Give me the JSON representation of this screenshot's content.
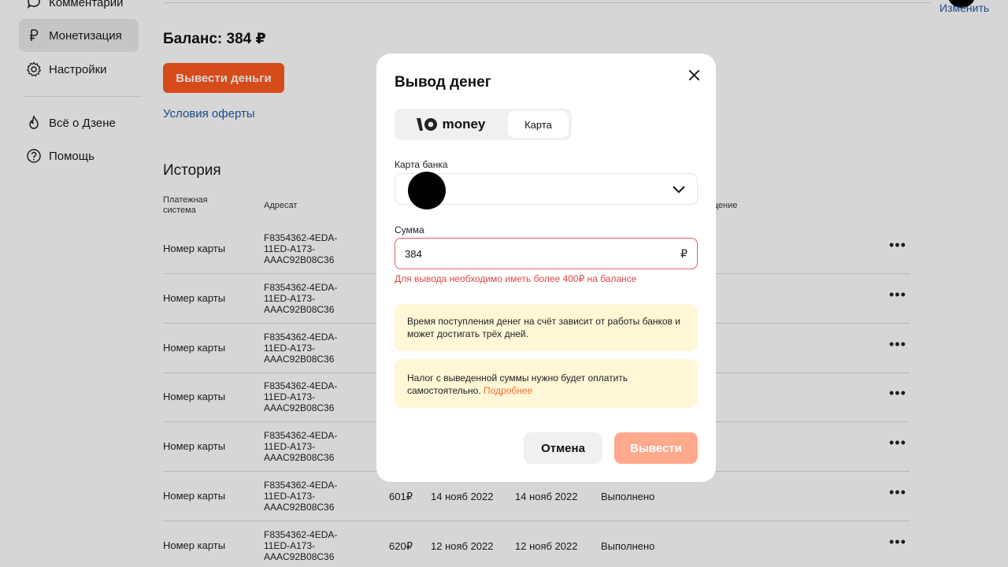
{
  "sidebar": {
    "items": [
      {
        "label": "Комментарии",
        "icon": "comment-icon"
      },
      {
        "label": "Монетизация",
        "icon": "ruble-icon",
        "active": true
      },
      {
        "label": "Настройки",
        "icon": "gear-icon"
      },
      {
        "label": "Всё о Дзене",
        "icon": "flame-icon"
      },
      {
        "label": "Помощь",
        "icon": "help-icon"
      }
    ]
  },
  "header": {
    "change_link": "Изменить"
  },
  "balance": {
    "text": "Баланс: 384 ₽",
    "withdraw_button": "Вывести деньги",
    "offer_link": "Условия оферты"
  },
  "history": {
    "title": "История",
    "columns": [
      "Платежная система",
      "Адресат",
      "щение"
    ],
    "rows": [
      {
        "system": "Номер карты",
        "address": "F8354362-4EDA-11ED-A173-AAAC92B08C36",
        "amount": "",
        "date1": "",
        "date2": "",
        "status": ""
      },
      {
        "system": "Номер карты",
        "address": "F8354362-4EDA-11ED-A173-AAAC92B08C36",
        "amount": "",
        "date1": "",
        "date2": "",
        "status": ""
      },
      {
        "system": "Номер карты",
        "address": "F8354362-4EDA-11ED-A173-AAAC92B08C36",
        "amount": "",
        "date1": "",
        "date2": "",
        "status": ""
      },
      {
        "system": "Номер карты",
        "address": "F8354362-4EDA-11ED-A173-AAAC92B08C36",
        "amount": "",
        "date1": "",
        "date2": "",
        "status": ""
      },
      {
        "system": "Номер карты",
        "address": "F8354362-4EDA-11ED-A173-AAAC92B08C36",
        "amount": "",
        "date1": "",
        "date2": "",
        "status": ""
      },
      {
        "system": "Номер карты",
        "address": "F8354362-4EDA-11ED-A173-AAAC92B08C36",
        "amount": "601₽",
        "date1": "14 нояб 2022",
        "date2": "14 нояб 2022",
        "status": "Выполнено"
      },
      {
        "system": "Номер карты",
        "address": "F8354362-4EDA-11ED-A173-AAAC92B08C36",
        "amount": "620₽",
        "date1": "12 нояб 2022",
        "date2": "12 нояб 2022",
        "status": "Выполнено"
      }
    ],
    "more_glyph": "•••"
  },
  "modal": {
    "title": "Вывод денег",
    "tabs": [
      {
        "label": "money",
        "selected": false
      },
      {
        "label": "Карта",
        "selected": true
      }
    ],
    "card_label": "Карта банка",
    "amount_label": "Сумма",
    "amount_value": "384",
    "currency": "₽",
    "error": "Для вывода необходимо иметь более 400₽ на балансе",
    "info1": "Время поступления денег на счёт зависит от работы банков и может достигать трёх дней.",
    "info2_text": "Налог с выведенной суммы нужно будет оплатить самостоятельно.",
    "info2_link": "Подробнее",
    "cancel": "Отмена",
    "submit": "Вывести"
  },
  "colors": {
    "accent": "#ff5a1f",
    "submit_disabled": "#ffa98c",
    "error": "#e04545",
    "link": "#1e5aa8",
    "info_bg": "#fff7d6"
  }
}
